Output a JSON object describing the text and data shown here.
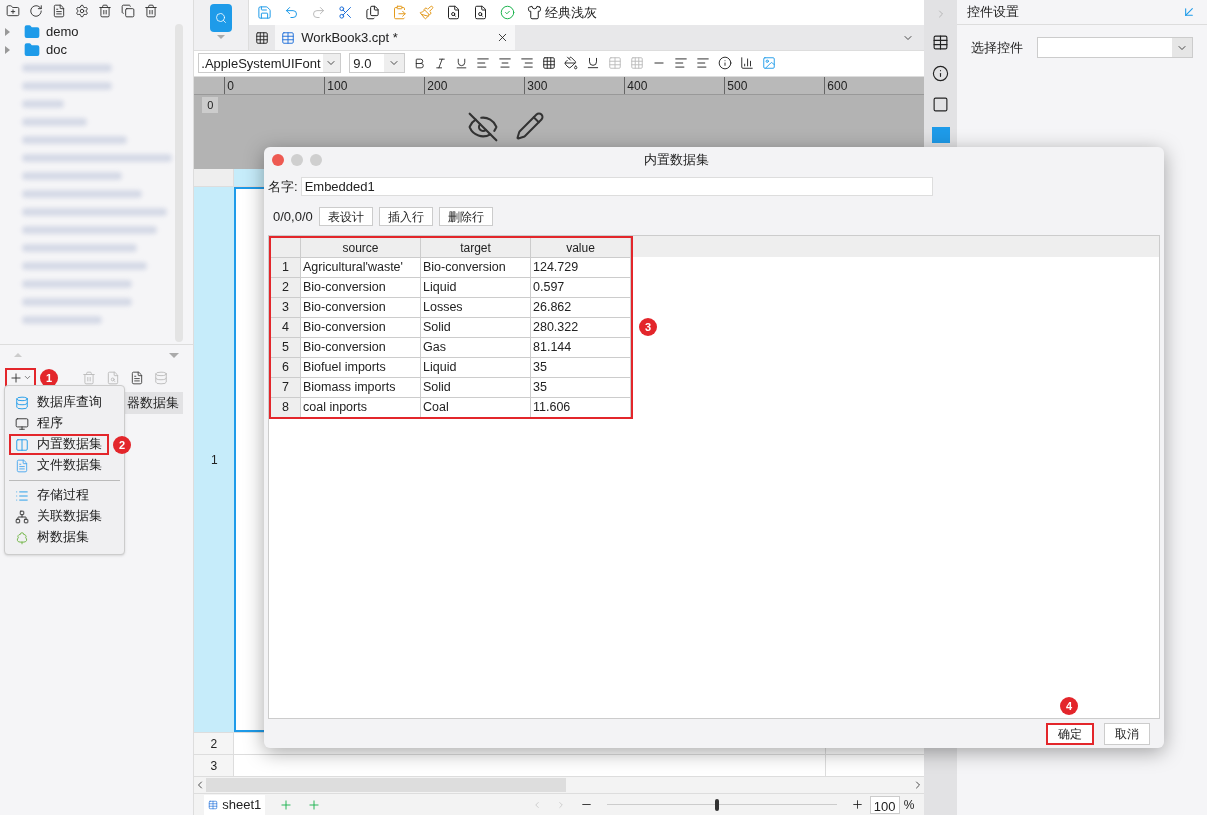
{
  "tree": {
    "items": [
      {
        "label": "demo"
      },
      {
        "label": "doc"
      }
    ]
  },
  "dataset_panel": {
    "add_button": {
      "highlighted": true,
      "badge": "1"
    },
    "tab_label": "器数据集",
    "menu": {
      "groups": [
        [
          {
            "label": "数据库查询",
            "kind": "database",
            "highlighted": false
          },
          {
            "label": "程序",
            "kind": "program",
            "highlighted": false
          },
          {
            "label": "内置数据集",
            "kind": "embedded",
            "highlighted": true,
            "badge": "2"
          },
          {
            "label": "文件数据集",
            "kind": "file",
            "highlighted": false
          }
        ],
        [
          {
            "label": "存储过程",
            "kind": "procedure",
            "highlighted": false
          },
          {
            "label": "关联数据集",
            "kind": "relation",
            "highlighted": false
          },
          {
            "label": "树数据集",
            "kind": "tree",
            "highlighted": false
          }
        ]
      ]
    }
  },
  "toolbar": {
    "theme_label": "经典浅灰"
  },
  "file_tab": {
    "title": "WorkBook3.cpt *"
  },
  "format_bar": {
    "font": ".AppleSystemUIFont",
    "size": "9.0"
  },
  "ruler": {
    "ticks": [
      "0",
      "100",
      "200",
      "300",
      "400",
      "500",
      "600"
    ],
    "vertical_tick": "0"
  },
  "sheet": {
    "rows": [
      "1",
      "2",
      "3"
    ]
  },
  "status_bar": {
    "sheet_tab": "sheet1",
    "zoom": "100",
    "zoom_unit": "%",
    "level": 0.48
  },
  "right_panel": {
    "title": "控件设置",
    "field_label": "选择控件"
  },
  "dialog": {
    "title": "内置数据集",
    "name_label": "名字:",
    "name_value": "Embedded1",
    "position": "0/0,0/0",
    "buttons": [
      "表设计",
      "插入行",
      "删除行"
    ],
    "table": {
      "highlighted": true,
      "badge": "3",
      "columns": [
        "source",
        "target",
        "value"
      ],
      "rows": [
        {
          "index": "1",
          "cells": [
            "Agricultural'waste'",
            "Bio-conversion",
            "124.729"
          ]
        },
        {
          "index": "2",
          "cells": [
            "Bio-conversion",
            "Liquid",
            "0.597"
          ]
        },
        {
          "index": "3",
          "cells": [
            "Bio-conversion",
            "Losses",
            "26.862"
          ]
        },
        {
          "index": "4",
          "cells": [
            "Bio-conversion",
            "Solid",
            "280.322"
          ]
        },
        {
          "index": "5",
          "cells": [
            "Bio-conversion",
            "Gas",
            "81.144"
          ]
        },
        {
          "index": "6",
          "cells": [
            "Biofuel imports",
            "Liquid",
            "35"
          ]
        },
        {
          "index": "7",
          "cells": [
            "Biomass imports",
            "Solid",
            "35"
          ]
        },
        {
          "index": "8",
          "cells": [
            "coal inports",
            "Coal",
            "11.606"
          ]
        }
      ]
    },
    "footer_buttons": [
      {
        "label": "确定",
        "highlighted": true,
        "badge": "4"
      },
      {
        "label": "取消",
        "highlighted": false
      }
    ]
  }
}
